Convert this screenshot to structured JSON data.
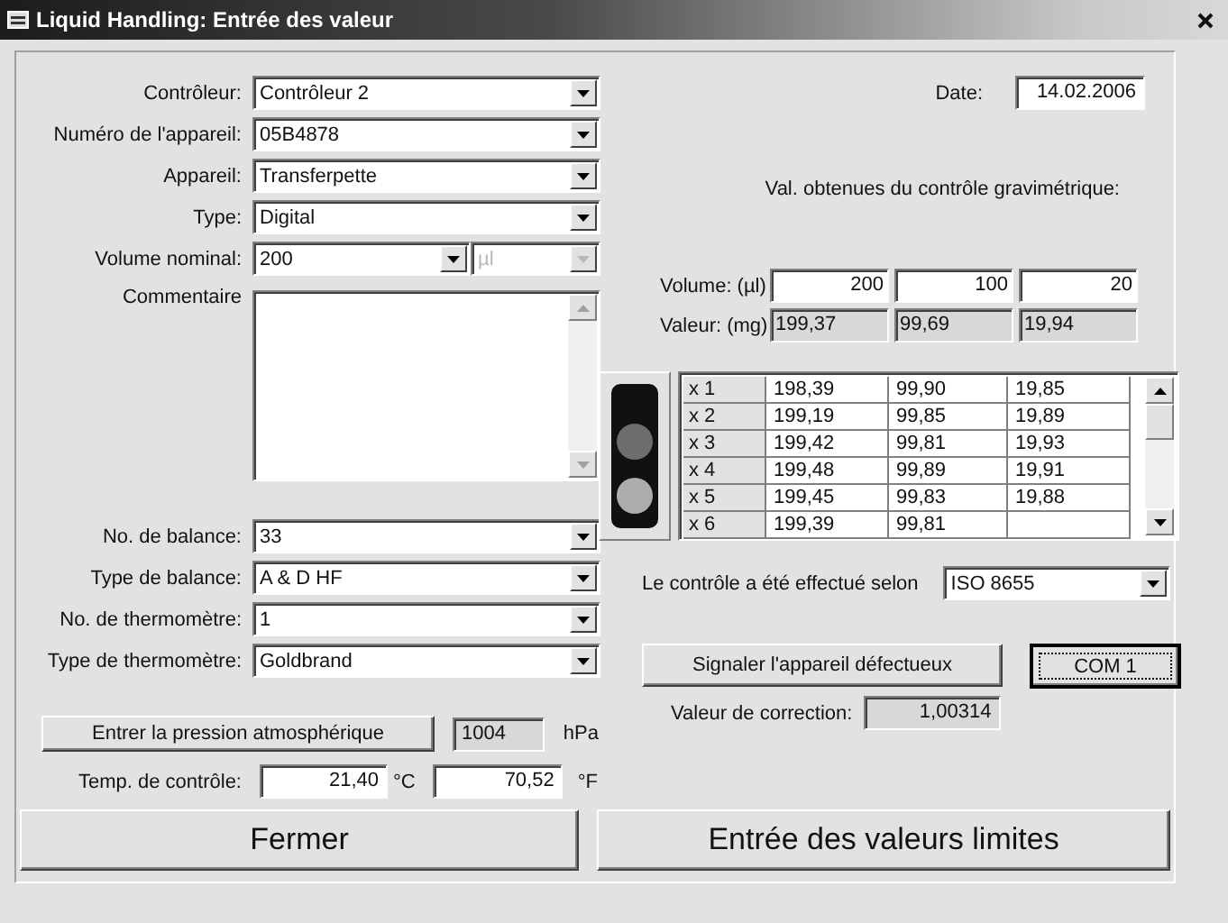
{
  "window": {
    "title": "Liquid Handling: Entrée des valeur"
  },
  "left_fields": [
    {
      "label": "Contrôleur:",
      "value": "Contrôleur 2"
    },
    {
      "label": "Numéro de l'appareil:",
      "value": "05B4878"
    },
    {
      "label": "Appareil:",
      "value": "Transferpette"
    },
    {
      "label": "Type:",
      "value": "Digital"
    },
    {
      "label": "Volume nominal:",
      "value": "200",
      "unit": {
        "value": "µl",
        "disabled": true
      }
    }
  ],
  "comment": {
    "label": "Commentaire"
  },
  "lower_fields": [
    {
      "label": "No. de balance:",
      "value": "33"
    },
    {
      "label": "Type de balance:",
      "value": "A & D HF"
    },
    {
      "label": "No. de thermomètre:",
      "value": "1"
    },
    {
      "label": "Type de thermomètre:",
      "value": "Goldbrand"
    }
  ],
  "pressure": {
    "button": "Entrer la pression atmosphérique",
    "value": "1004",
    "unit": "hPa"
  },
  "temperature": {
    "label": "Temp. de contrôle:",
    "celsius": "21,40",
    "celsius_unit": "°C",
    "fahrenheit": "70,52",
    "fahrenheit_unit": "°F"
  },
  "date": {
    "label": "Date:",
    "value": "14.02.2006"
  },
  "results": {
    "heading": "Val. obtenues du contrôle gravimétrique:",
    "volume_label": "Volume: (µl)",
    "volumes": [
      "200",
      "100",
      "20"
    ],
    "value_label": "Valeur: (mg)",
    "values": [
      "199,37",
      "99,69",
      "19,94"
    ]
  },
  "traffic_light": {
    "lamps": [
      {
        "color": "#6e6e6e"
      },
      {
        "color": "#adadad"
      }
    ]
  },
  "measurements": [
    {
      "label": "x 1",
      "values": [
        "198,39",
        "99,90",
        "19,85"
      ]
    },
    {
      "label": "x 2",
      "values": [
        "199,19",
        "99,85",
        "19,89"
      ]
    },
    {
      "label": "x 3",
      "values": [
        "199,42",
        "99,81",
        "19,93"
      ]
    },
    {
      "label": "x 4",
      "values": [
        "199,48",
        "99,89",
        "19,91"
      ]
    },
    {
      "label": "x 5",
      "values": [
        "199,45",
        "99,83",
        "19,88"
      ]
    },
    {
      "label": "x 6",
      "values": [
        "199,39",
        "99,81"
      ]
    }
  ],
  "standard": {
    "label": "Le contrôle a été effectué selon",
    "value": "ISO 8655"
  },
  "defect_button": "Signaler l'appareil défectueux",
  "com_button": {
    "label": "COM 1",
    "focused": true
  },
  "correction": {
    "label": "Valeur de correction:",
    "value": "1,00314"
  },
  "buttons": [
    "Fermer",
    "Entrée des valeurs limites"
  ]
}
